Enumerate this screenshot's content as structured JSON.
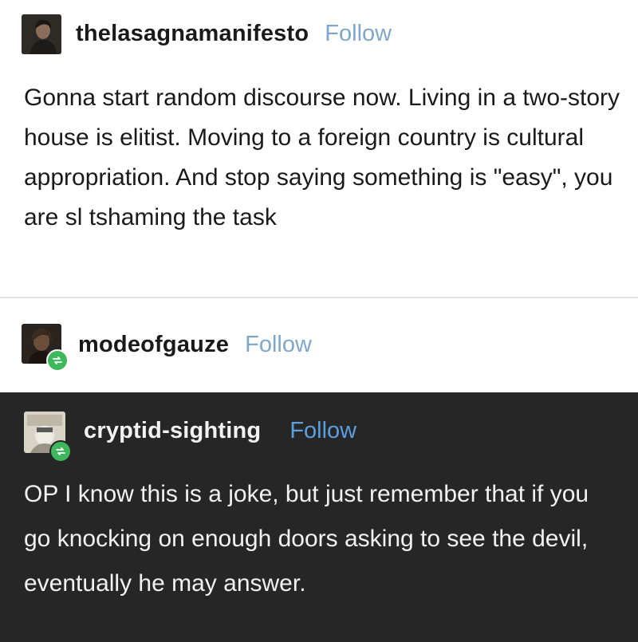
{
  "posts": [
    {
      "username": "thelasagnamanifesto",
      "follow_label": "Follow",
      "body": "Gonna start random discourse now. Living in a two-story house is elitist. Moving to a foreign country is cultural appropriation. And stop saying something is \"easy\", you are sl  tshaming the task"
    },
    {
      "username": "modeofgauze",
      "follow_label": "Follow"
    },
    {
      "username": "cryptid-sighting",
      "follow_label": "Follow",
      "body": "OP I know this is a joke, but just remember that if you go knocking on enough doors asking to see the devil, eventually he may answer."
    }
  ],
  "colors": {
    "follow_light": "#7fa7c9",
    "follow_dark": "#5aa0e0",
    "text_light": "#1a1a1a",
    "text_dark": "#f2f2f2",
    "dark_bg": "#262626",
    "reblog_green": "#3fb75d"
  },
  "icons": [
    "avatar-thelasagnamanifesto",
    "avatar-modeofgauze",
    "avatar-cryptid-sighting",
    "reblog-icon"
  ]
}
